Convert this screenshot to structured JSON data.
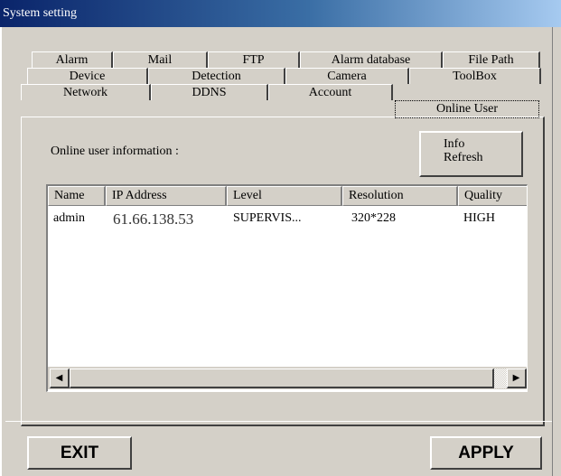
{
  "window": {
    "title": "System setting"
  },
  "tabs": {
    "row1": [
      "Alarm",
      "Mail",
      "FTP",
      "Alarm database",
      "File Path"
    ],
    "row2": [
      "Device",
      "Detection",
      "Camera",
      "ToolBox"
    ],
    "row3": [
      "Network",
      "DDNS",
      "Account",
      "Online User"
    ],
    "active": "Online User"
  },
  "online_user": {
    "info_label": "Online user information :",
    "refresh_button": [
      "Info",
      "Refresh"
    ],
    "columns": [
      "Name",
      "IP Address",
      "Level",
      "Resolution",
      "Quality"
    ],
    "rows": [
      {
        "name": "admin",
        "ip": "61.66.138.53",
        "level": "SUPERVIS...",
        "resolution": "320*228",
        "quality": "HIGH"
      }
    ],
    "scroll_left_icon": "triangle-left",
    "scroll_right_icon": "triangle-right"
  },
  "buttons": {
    "exit": "EXIT",
    "apply": "APPLY"
  }
}
